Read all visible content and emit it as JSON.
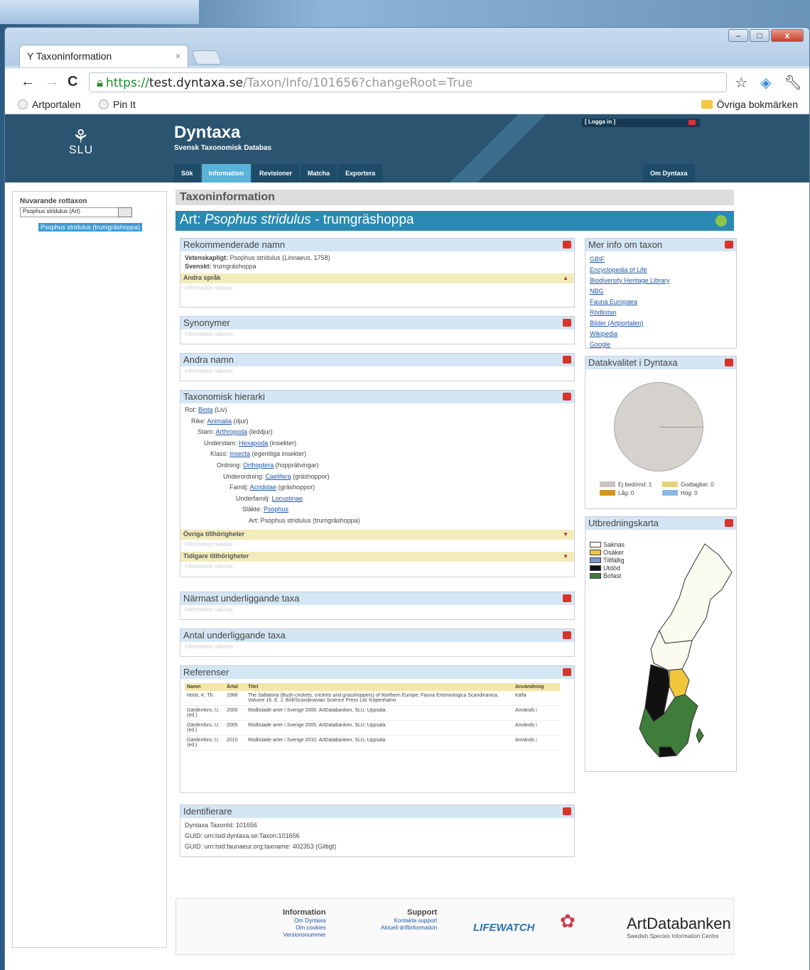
{
  "browser": {
    "tab_title": "Taxoninformation",
    "tab_close": "×",
    "url_scheme": "https://",
    "url_host": "test.dyntaxa.se",
    "url_path": "/Taxon/Info/101656?changeRoot=True",
    "bookmarks": [
      "Artportalen",
      "Pin It"
    ],
    "other_bookmarks": "Övriga bokmärken"
  },
  "site": {
    "logo_text": "SLU",
    "title": "Dyntaxa",
    "subtitle": "Svensk Taxonomisk Databas",
    "login": "[ Logga in ]",
    "menu": [
      "Sök",
      "Information",
      "Revisioner",
      "Matcha",
      "Exportera",
      "Om Dyntaxa"
    ]
  },
  "left": {
    "label": "Nuvarande rottaxon",
    "select_value": "Psophus stridulus (Art)",
    "tree_node": "Psophus stridulus (trumgräshoppa)"
  },
  "main": {
    "page_title": "Taxoninformation",
    "art_prefix": "Art:",
    "art_sci": "Psophus stridulus",
    "art_common": " - trumgräshoppa",
    "rek": {
      "title": "Rekommenderade namn",
      "vet_label": "Vetenskapligt:",
      "vet_value": "Psophus stridulus (Linnaeus, 1758)",
      "sv_label": "Svenskt:",
      "sv_value": "trumgräshoppa",
      "other_lang": "Andra språk",
      "placeholder": "Information saknas"
    },
    "syn": {
      "title": "Synonymer",
      "placeholder": "Information saknas"
    },
    "andra": {
      "title": "Andra namn",
      "placeholder": "Information saknas"
    },
    "hier": {
      "title": "Taxonomisk hierarki",
      "rows": [
        {
          "rank": "Rot:",
          "link": "Biota",
          "rest": " (Liv)"
        },
        {
          "rank": "Rike:",
          "link": "Animalia",
          "rest": " (djur)"
        },
        {
          "rank": "Stam:",
          "link": "Arthropoda",
          "rest": " (leddjur)"
        },
        {
          "rank": "Understam:",
          "link": "Hexapoda",
          "rest": " (insekter)"
        },
        {
          "rank": "Klass:",
          "link": "Insecta",
          "rest": " (egentliga insekter)"
        },
        {
          "rank": "Ordning:",
          "link": "Orthoptera",
          "rest": " (hopprätvingar)"
        },
        {
          "rank": "Underordning:",
          "link": "Caelifera",
          "rest": " (gräshoppor)"
        },
        {
          "rank": "Familj:",
          "link": "Acrididae",
          "rest": " (gräshoppor)"
        },
        {
          "rank": "Underfamilj:",
          "link": "Locustinae",
          "rest": ""
        },
        {
          "rank": "Släkte:",
          "link": "Psophus",
          "rest": ""
        },
        {
          "rank": "Art:",
          "link": "",
          "rest": "Psophus stridulus (trumgräshoppa)"
        }
      ],
      "other": "Övriga tillhörigheter",
      "previous": "Tidigare tillhörigheter",
      "placeholder": "Information saknas"
    },
    "narm": {
      "title": "Närmast underliggande taxa",
      "placeholder": "Information saknas"
    },
    "antal": {
      "title": "Antal underliggande taxa",
      "placeholder": "Information saknas"
    },
    "ref": {
      "title": "Referenser",
      "headers": [
        "Namn",
        "Årtal",
        "Titel",
        "Användning"
      ],
      "rows": [
        [
          "Holst, K. Th.",
          "1986",
          "The Saltatoria (Bush-crickets, crickets and grasshoppers) of Northern Europe. Fauna Entomologica Scandinavica, Volume 16. E. J. Brill/Scandinavian Science Press Ltd. Köpenhamn",
          "Källa"
        ],
        [
          "Gärdenfors, U. (ed.)",
          "2000",
          "Rödlistade arter i Sverige 2000. ArtDatabanken, SLU, Uppsala.",
          "Används i"
        ],
        [
          "Gärdenfors, U. (ed.)",
          "2005",
          "Rödlistade arter i Sverige 2005. ArtDatabanken, SLU, Uppsala.",
          "Används i"
        ],
        [
          "Gärdenfors, U. (ed.)",
          "2010",
          "Rödlistade arter i Sverige 2010. ArtDatabanken, SLU, Uppsala",
          "Används i"
        ]
      ]
    },
    "ident": {
      "title": "Identifierare",
      "rows": [
        "Dyntaxa TaxonId: 101656",
        "GUID: urn:lsid:dyntaxa.se:Taxon:101656",
        "GUID: urn:lsid:faunaeur.org:taxname: 402353 (Giltigt)"
      ]
    }
  },
  "right": {
    "mer": {
      "title": "Mer info om taxon",
      "links": [
        "GBIF",
        "Encyclopedia of Life",
        "Biodiversity Heritage Library",
        "NBG",
        "Fauna Europaea",
        "Rödlistan",
        "Bilder (Artportalen)",
        "Wikipedia",
        "Google"
      ]
    },
    "dq": {
      "title": "Datakvalitet i Dyntaxa",
      "legend": [
        "Ej bedömd: 1",
        "Godtagbar: 0",
        "Låg: 0",
        "Hög: 0"
      ]
    },
    "map": {
      "title": "Utbredningskarta",
      "legend": [
        "Saknas",
        "Osäker",
        "Tillfällig",
        "Utdöd",
        "Bofast"
      ]
    }
  },
  "footer": {
    "info_title": "Information",
    "info_links": [
      "Om Dyntaxa",
      "Om cookies",
      "Versionsnummer"
    ],
    "support_title": "Support",
    "support_links": [
      "Kontakta support",
      "Aktuell driftinformation"
    ],
    "lifewatch": "LIFEWATCH",
    "ad_name": "ArtDatabanken",
    "ad_sub": "Swedish Species Information Centre"
  },
  "colors": {
    "accent": "#2a8ab3",
    "header": "#2a5470",
    "map_green": "#3f7d3a",
    "map_yellow": "#f0c73b"
  }
}
